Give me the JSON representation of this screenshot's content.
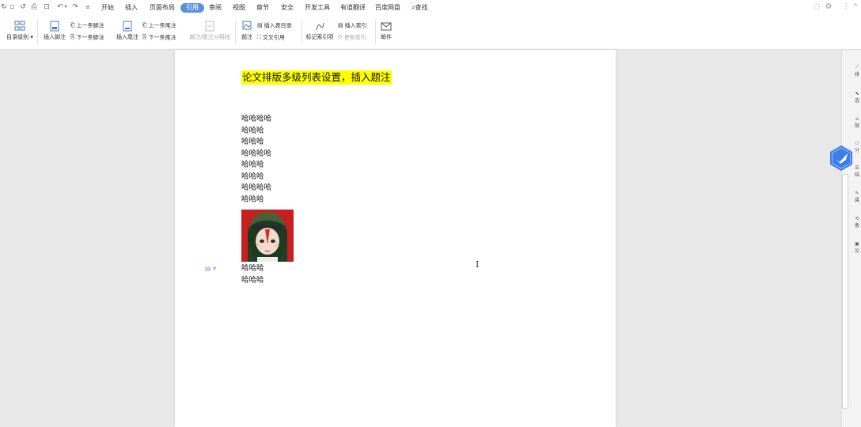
{
  "menubar": {
    "tabs": [
      {
        "label": "开始"
      },
      {
        "label": "插入"
      },
      {
        "label": "页面布局"
      },
      {
        "label": "引用"
      },
      {
        "label": "审阅"
      },
      {
        "label": "视图"
      },
      {
        "label": "章节"
      },
      {
        "label": "安全"
      },
      {
        "label": "开发工具"
      },
      {
        "label": "有道翻译"
      },
      {
        "label": "百度网盘"
      }
    ],
    "search_label": "查找",
    "active_tab": "引用"
  },
  "ribbon": {
    "toc_level": "目录级别",
    "insert_footnote": "插入脚注",
    "prev_footnote": "上一条脚注",
    "next_footnote": "下一条脚注",
    "insert_endnote": "插入尾注",
    "prev_endnote": "上一条尾注",
    "next_endnote": "下一条尾注",
    "footnote_separator": "脚注/尾注分隔线",
    "caption": "题注",
    "insert_table_of_figures": "插入表目录",
    "cross_reference": "交叉引用",
    "mark_index_entry": "标记索引项",
    "insert_index": "插入索引",
    "update_index": "更新索引",
    "mail": "邮件"
  },
  "document": {
    "title": "论文排版多级列表设置，插入题注",
    "lines_before_image": [
      "哈哈哈哈",
      "哈哈哈",
      "哈哈哈",
      "哈哈哈哈",
      "哈哈哈",
      "哈哈哈",
      "哈哈哈哈",
      "哈哈哈"
    ],
    "lines_after_image": [
      "哈哈哈",
      "哈哈哈"
    ]
  },
  "colors": {
    "accent": "#5a8fe0",
    "highlight": "#ffff00",
    "badge": "#3d7de8"
  }
}
